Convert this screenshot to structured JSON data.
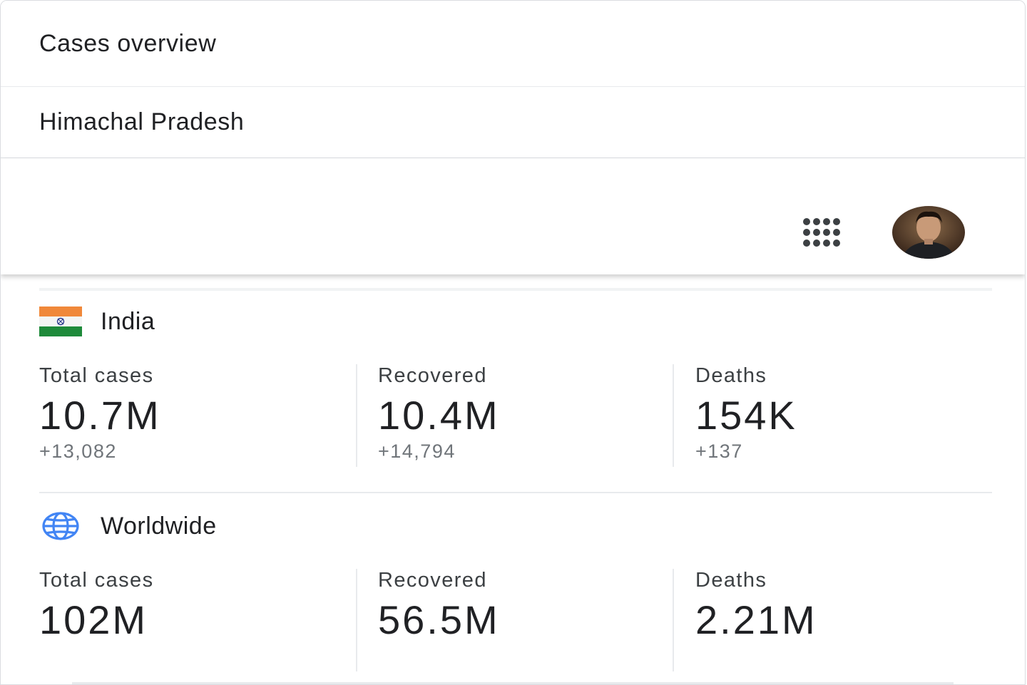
{
  "dropdown": {
    "options": [
      {
        "label": "Cases overview"
      },
      {
        "label": "Himachal Pradesh"
      }
    ]
  },
  "header": {
    "apps_icon": "apps-grid-icon",
    "avatar_icon": "account-avatar"
  },
  "regions": [
    {
      "name": "India",
      "icon": "india-flag-icon",
      "stats": [
        {
          "label": "Total cases",
          "value": "10.7M",
          "delta": "+13,082"
        },
        {
          "label": "Recovered",
          "value": "10.4M",
          "delta": "+14,794"
        },
        {
          "label": "Deaths",
          "value": "154K",
          "delta": "+137"
        }
      ]
    },
    {
      "name": "Worldwide",
      "icon": "globe-icon",
      "stats": [
        {
          "label": "Total cases",
          "value": "102M"
        },
        {
          "label": "Recovered",
          "value": "56.5M"
        },
        {
          "label": "Deaths",
          "value": "2.21M"
        }
      ]
    }
  ],
  "colors": {
    "globe": "#4285f4",
    "flag_saffron": "#f0883a",
    "flag_green": "#1e8a3a",
    "flag_chakra": "#2a3a8c",
    "divider": "#e8eaed"
  }
}
